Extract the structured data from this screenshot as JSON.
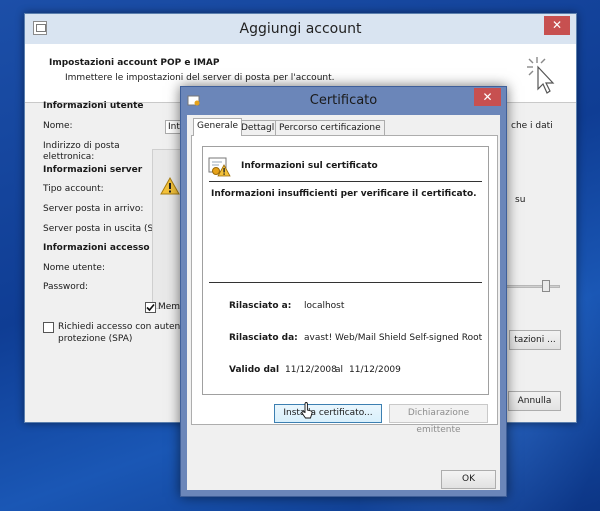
{
  "add_account": {
    "title": "Aggiungi account",
    "close_glyph": "✕",
    "header_title": "Impostazioni account POP e IMAP",
    "header_subtitle": "Immettere le impostazioni del server di posta per l'account.",
    "sections": {
      "user": "Informazioni utente",
      "server": "Informazioni server",
      "access": "Informazioni accesso"
    },
    "labels": {
      "name": "Nome:",
      "email_line1": "Indirizzo di posta",
      "email_line2": "elettronica:",
      "account_type": "Tipo account:",
      "incoming": "Server posta in arrivo:",
      "outgoing": "Server posta in uscita (SMT",
      "username": "Nome utente:",
      "password": "Password:"
    },
    "name_input_value": "Int",
    "remember_label": "Memo",
    "remember_checked": true,
    "spa_line1": "Richiedi accesso con autentica",
    "spa_line2": "protezione (SPA)",
    "spa_checked": false,
    "right_text_1": "che i dati",
    "right_text_2": "su",
    "more_settings_label": "tazioni ...",
    "cancel_label": "Annulla"
  },
  "certificate": {
    "title": "Certificato",
    "close_glyph": "✕",
    "tabs": [
      {
        "label": "Generale",
        "active": true
      },
      {
        "label": "Dettagli",
        "active": false
      },
      {
        "label": "Percorso certificazione",
        "active": false
      }
    ],
    "info_title": "Informazioni sul certificato",
    "warning": "Informazioni insufficienti per verificare il certificato.",
    "issued_to_label": "Rilasciato a:",
    "issued_to_value": "localhost",
    "issued_by_label": "Rilasciato da:",
    "issued_by_value": "avast! Web/Mail Shield Self-signed Root",
    "valid_from_label": "Valido dal",
    "valid_from_value": "11/12/2008",
    "valid_to_word": "al",
    "valid_to_value": "11/12/2009",
    "install_button": "Installa certificato...",
    "issuer_statement_button": "Dichiarazione emittente",
    "ok_button": "OK"
  },
  "colors": {
    "desktop": "#1a4ea8",
    "front_window_frame": "#6b86b9",
    "close_button": "#c75050",
    "warning_yellow": "#f4c23a"
  }
}
